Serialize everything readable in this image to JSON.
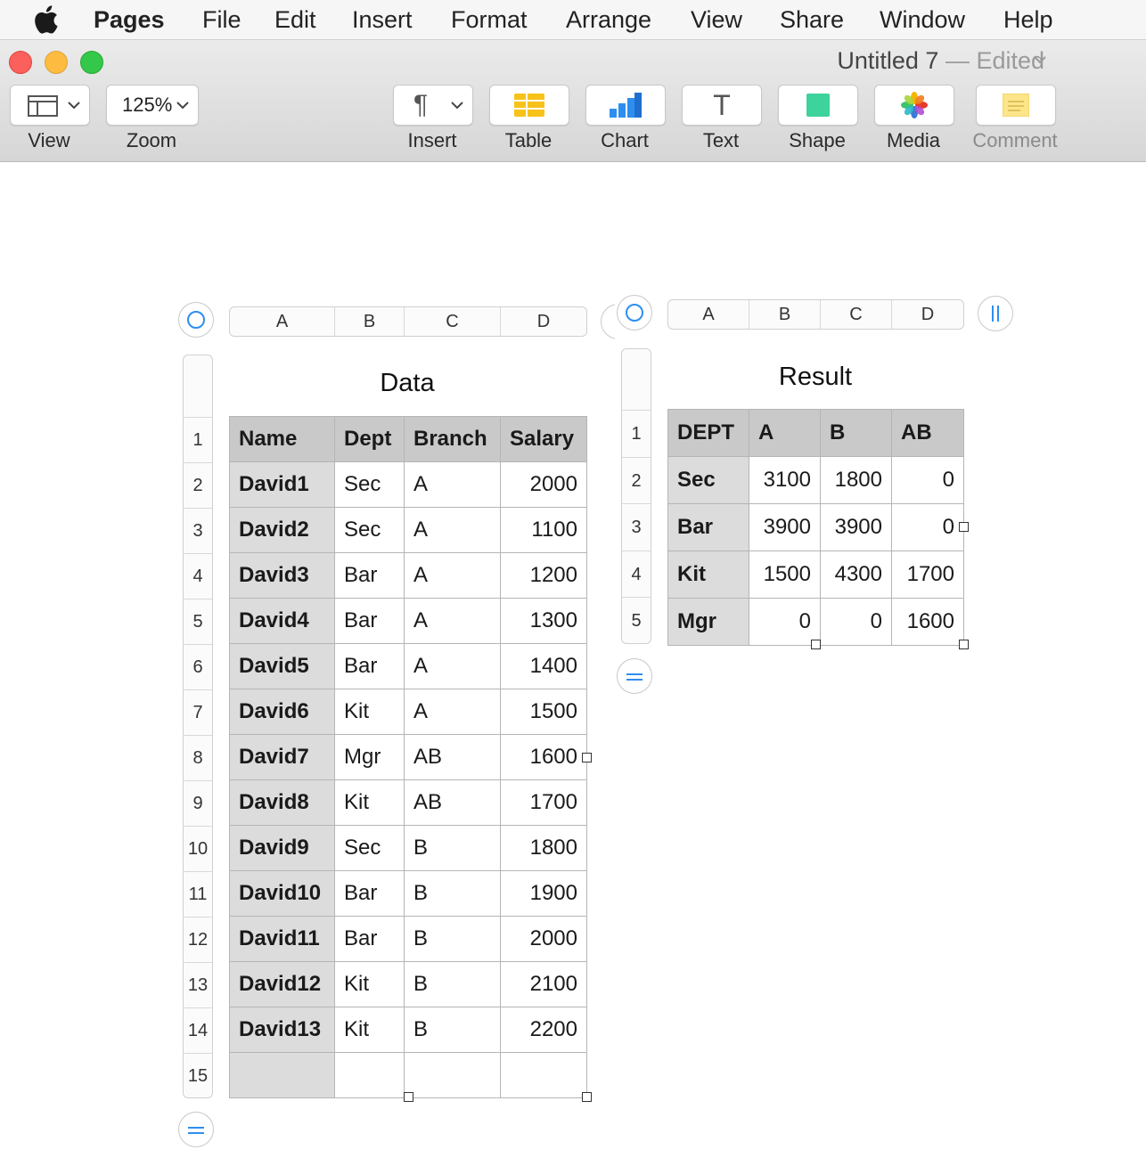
{
  "menubar": {
    "app": "Pages",
    "items": [
      "File",
      "Edit",
      "Insert",
      "Format",
      "Arrange",
      "View",
      "Share",
      "Window",
      "Help"
    ]
  },
  "window": {
    "title": "Untitled 7",
    "status": "— Edited",
    "chevron": "⌄"
  },
  "toolbar": {
    "view_label": "View",
    "zoom_value": "125%",
    "zoom_label": "Zoom",
    "insert_label": "Insert",
    "table_label": "Table",
    "chart_label": "Chart",
    "text_label": "Text",
    "text_icon_glyph": "T",
    "shape_label": "Shape",
    "media_label": "Media",
    "comment_label": "Comment",
    "pilcrow": "¶"
  },
  "data_table": {
    "title": "Data",
    "col_letters": [
      "A",
      "B",
      "C",
      "D"
    ],
    "row_numbers": [
      "1",
      "2",
      "3",
      "4",
      "5",
      "6",
      "7",
      "8",
      "9",
      "10",
      "11",
      "12",
      "13",
      "14",
      "15"
    ],
    "headers": [
      "Name",
      "Dept",
      "Branch",
      "Salary"
    ],
    "rows": [
      [
        "David1",
        "Sec",
        "A",
        "2000"
      ],
      [
        "David2",
        "Sec",
        "A",
        "1100"
      ],
      [
        "David3",
        "Bar",
        "A",
        "1200"
      ],
      [
        "David4",
        "Bar",
        "A",
        "1300"
      ],
      [
        "David5",
        "Bar",
        "A",
        "1400"
      ],
      [
        "David6",
        "Kit",
        "A",
        "1500"
      ],
      [
        "David7",
        "Mgr",
        "AB",
        "1600"
      ],
      [
        "David8",
        "Kit",
        "AB",
        "1700"
      ],
      [
        "David9",
        "Sec",
        "B",
        "1800"
      ],
      [
        "David10",
        "Bar",
        "B",
        "1900"
      ],
      [
        "David11",
        "Bar",
        "B",
        "2000"
      ],
      [
        "David12",
        "Kit",
        "B",
        "2100"
      ],
      [
        "David13",
        "Kit",
        "B",
        "2200"
      ],
      [
        "",
        "",
        "",
        ""
      ]
    ]
  },
  "result_table": {
    "title": "Result",
    "col_letters": [
      "A",
      "B",
      "C",
      "D"
    ],
    "row_numbers": [
      "1",
      "2",
      "3",
      "4",
      "5"
    ],
    "headers": [
      "DEPT",
      "A",
      "B",
      "AB"
    ],
    "rows": [
      [
        "Sec",
        "3100",
        "1800",
        "0"
      ],
      [
        "Bar",
        "3900",
        "3900",
        "0"
      ],
      [
        "Kit",
        "1500",
        "4300",
        "1700"
      ],
      [
        "Mgr",
        "0",
        "0",
        "1600"
      ]
    ]
  },
  "colors": {
    "accent": "#2d8ef0",
    "header_fill": "#c9c9c9",
    "rowheader_fill": "#dcdcdc",
    "close": "#fc605c",
    "minimize": "#fdbc40",
    "zoom": "#34c84a"
  },
  "icons": {
    "apple": "apple-logo-icon",
    "view": "sidebar-layout-icon",
    "table": "table-icon",
    "chart": "bar-chart-icon",
    "shape": "square-shape-icon",
    "media": "photos-flower-icon",
    "comment": "sticky-note-icon"
  }
}
